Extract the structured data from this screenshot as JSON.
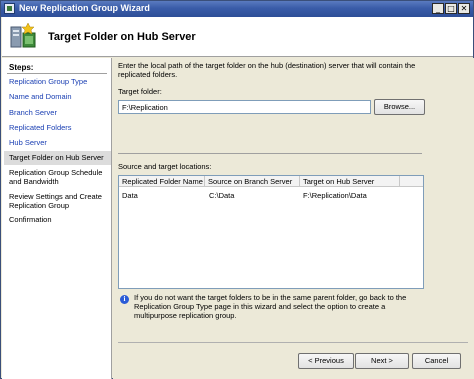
{
  "window": {
    "title": "New Replication Group Wizard",
    "controls": {
      "minimize": "_",
      "maximize": "□",
      "close": "✕"
    }
  },
  "header": {
    "title": "Target Folder on Hub Server",
    "icon": "replication-folder-icon"
  },
  "sidebar": {
    "steps_label": "Steps:",
    "steps": [
      {
        "label": "Replication Group Type"
      },
      {
        "label": "Name and Domain"
      },
      {
        "label": "Branch Server"
      },
      {
        "label": "Replicated Folders"
      },
      {
        "label": "Hub Server"
      },
      {
        "label": "Target Folder on Hub Server"
      },
      {
        "label": "Replication Group Schedule and Bandwidth"
      },
      {
        "label": "Review Settings and Create Replication Group"
      },
      {
        "label": "Confirmation"
      }
    ]
  },
  "main": {
    "instructions": "Enter the local path of the target folder on the hub (destination) server that will contain the replicated folders.",
    "target_folder_label": "Target folder:",
    "target_folder_value": "F:\\Replication",
    "browse_label": "Browse...",
    "locations_label": "Source and target locations:",
    "table": {
      "columns": [
        "Replicated Folder Name",
        "Source on Branch Server",
        "Target on Hub Server"
      ],
      "rows": [
        [
          "Data",
          "C:\\Data",
          "F:\\Replication\\Data"
        ]
      ]
    },
    "info_text": "If you do not want the target folders to be in the same parent folder, go back to the Replication Group Type page in this wizard and select the option to create a multipurpose replication group."
  },
  "footer": {
    "previous_label": "< Previous",
    "next_label": "Next >",
    "cancel_label": "Cancel"
  },
  "colors": {
    "link": "#1a3fb3",
    "titlebar": "#3a5ca8",
    "selected_step": "#dcdcdc"
  }
}
